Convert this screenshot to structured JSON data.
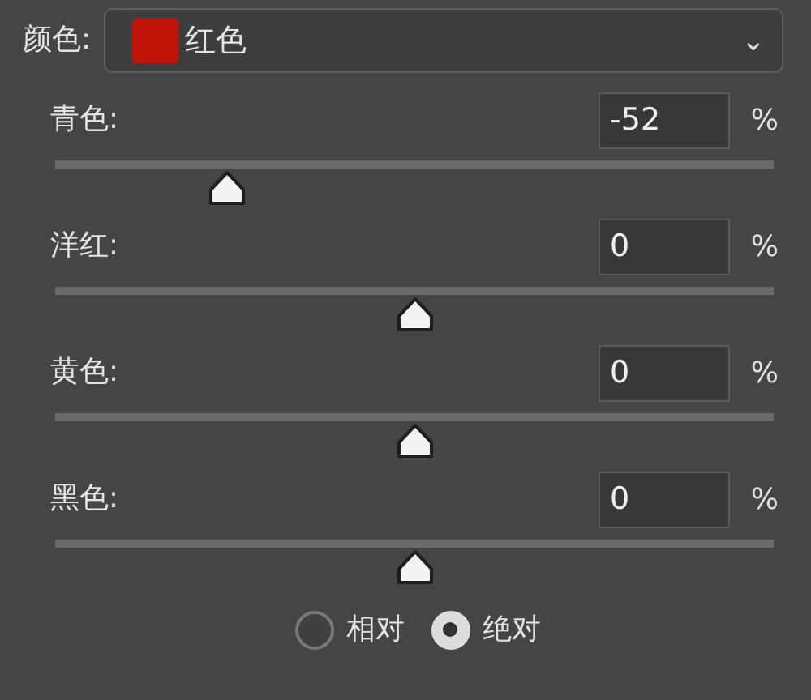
{
  "color_picker": {
    "label": "颜色:",
    "color": "#c01409",
    "value": "红色",
    "caret": "⌄"
  },
  "sliders": [
    {
      "label": "青色:",
      "value": "-52",
      "unit": "%",
      "level": 0.24
    },
    {
      "label": "洋红:",
      "value": "0",
      "unit": "%",
      "level": 0.5
    },
    {
      "label": "黄色:",
      "value": "0",
      "unit": "%",
      "level": 0.5
    },
    {
      "label": "黑色:",
      "value": "0",
      "unit": "%",
      "level": 0.5
    }
  ],
  "method": [
    {
      "label": "相对",
      "selected": false
    },
    {
      "label": "绝对",
      "selected": true
    }
  ]
}
